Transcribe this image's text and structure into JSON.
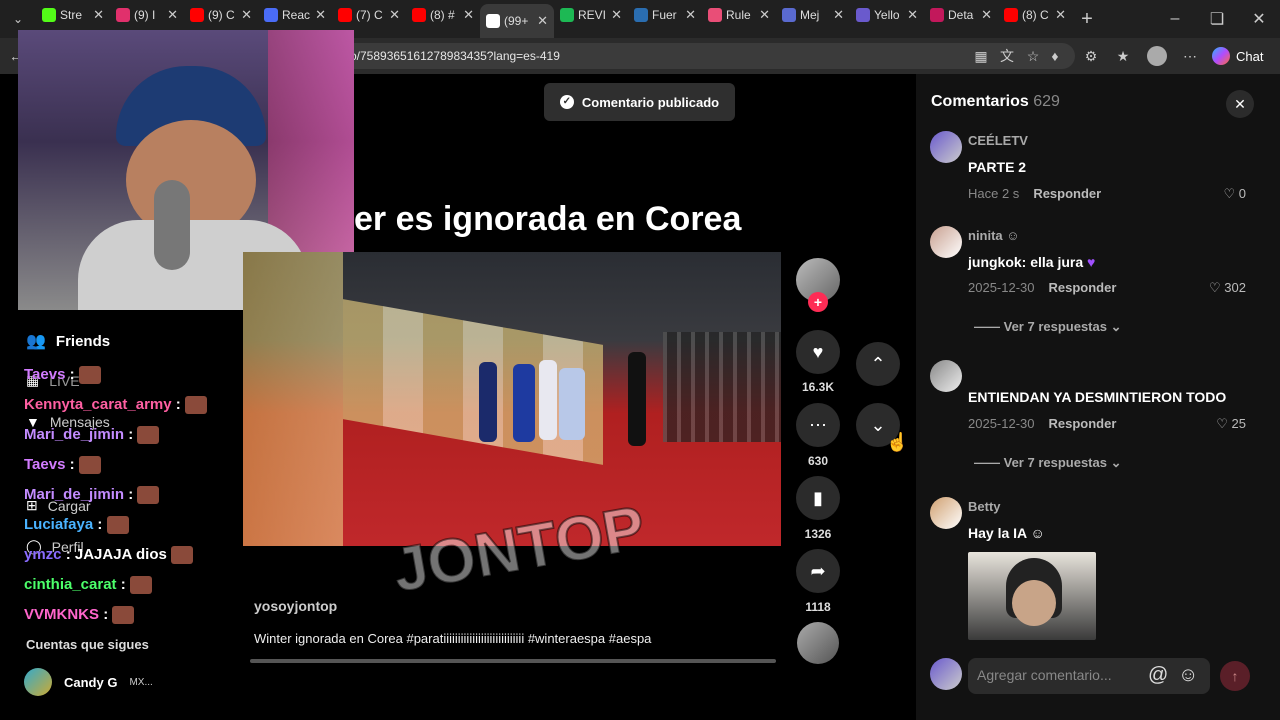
{
  "browser": {
    "tabs": [
      {
        "label": "Stre",
        "color": "#53fc18"
      },
      {
        "label": "(9) I",
        "color": "#e1306c"
      },
      {
        "label": "(9) C",
        "color": "#ff0000"
      },
      {
        "label": "Reac",
        "color": "#4a6cf7"
      },
      {
        "label": "(7) C",
        "color": "#ff0000"
      },
      {
        "label": "(8) #",
        "color": "#ff0000"
      },
      {
        "label": "(99+",
        "color": "#ffffff"
      },
      {
        "label": "REVI",
        "color": "#1db954"
      },
      {
        "label": "Fuer",
        "color": "#2a6db0"
      },
      {
        "label": "Rule",
        "color": "#e94e77"
      },
      {
        "label": "Mej",
        "color": "#5a6acf"
      },
      {
        "label": "Yello",
        "color": "#6a5acd"
      },
      {
        "label": "Deta",
        "color": "#c2185b"
      },
      {
        "label": "(8) C",
        "color": "#ff0000"
      }
    ],
    "url": "o/7589365161278983435?lang=es-419",
    "chat_button": "Chat"
  },
  "left_nav": {
    "friends": "Friends",
    "live": "LIVE",
    "messages": "Mensajes",
    "upload": "Cargar",
    "profile": "Perfil",
    "following_title": "Cuentas que sigues",
    "followed_user": "Candy G",
    "followed_suffix": "MX..."
  },
  "chat_overlay": [
    {
      "user": "Taevs",
      "msg": ":",
      "color": "#d27cff"
    },
    {
      "user": "Kennyta_carat_army",
      "msg": ":",
      "color": "#ff5fa2"
    },
    {
      "user": "Mari_de_jimin",
      "msg": ":",
      "color": "#c38cff"
    },
    {
      "user": "Taevs",
      "msg": ":",
      "color": "#d27cff"
    },
    {
      "user": "Mari_de_jimin",
      "msg": ":",
      "color": "#c38cff"
    },
    {
      "user": "Luciafaya",
      "msg": ":",
      "color": "#4ab3ff"
    },
    {
      "user": "ymzc",
      "msg": ": JAJAJA dios",
      "color": "#8a6cff"
    },
    {
      "user": "cinthia_carat",
      "msg": ":",
      "color": "#4cff6a"
    },
    {
      "user": "VVMKNKS",
      "msg": ":",
      "color": "#ff66cc"
    }
  ],
  "toast": "Comentario publicado",
  "video": {
    "caption_title": "er es ignorada en Corea",
    "watermark": "JONTOP",
    "author": "yosoyjontop",
    "description": "Winter ignorada en Corea #paratiiiiiiiiiiiiiiiiiiiiiiiiiiii #winteraespa #aespa"
  },
  "actions": {
    "likes": "16.3K",
    "comments": "630",
    "saves": "1326",
    "shares": "1118"
  },
  "comments_panel": {
    "title": "Comentarios",
    "count": "629",
    "items": [
      {
        "user": "CEÉLETV",
        "text": "PARTE 2",
        "time": "Hace 2 s",
        "reply": "Responder",
        "likes": "0"
      },
      {
        "user": "ninita",
        "text": "jungkok: ella jura",
        "time": "2025-12-30",
        "reply": "Responder",
        "likes": "302",
        "replies": "Ver 7 respuestas"
      },
      {
        "user": "",
        "text": "ENTIENDAN YA DESMINTIERON TODO",
        "time": "2025-12-30",
        "reply": "Responder",
        "likes": "25",
        "replies": "Ver 7 respuestas"
      },
      {
        "user": "Betty",
        "text": "Hay la IA"
      }
    ],
    "input_placeholder": "Agregar comentario..."
  }
}
